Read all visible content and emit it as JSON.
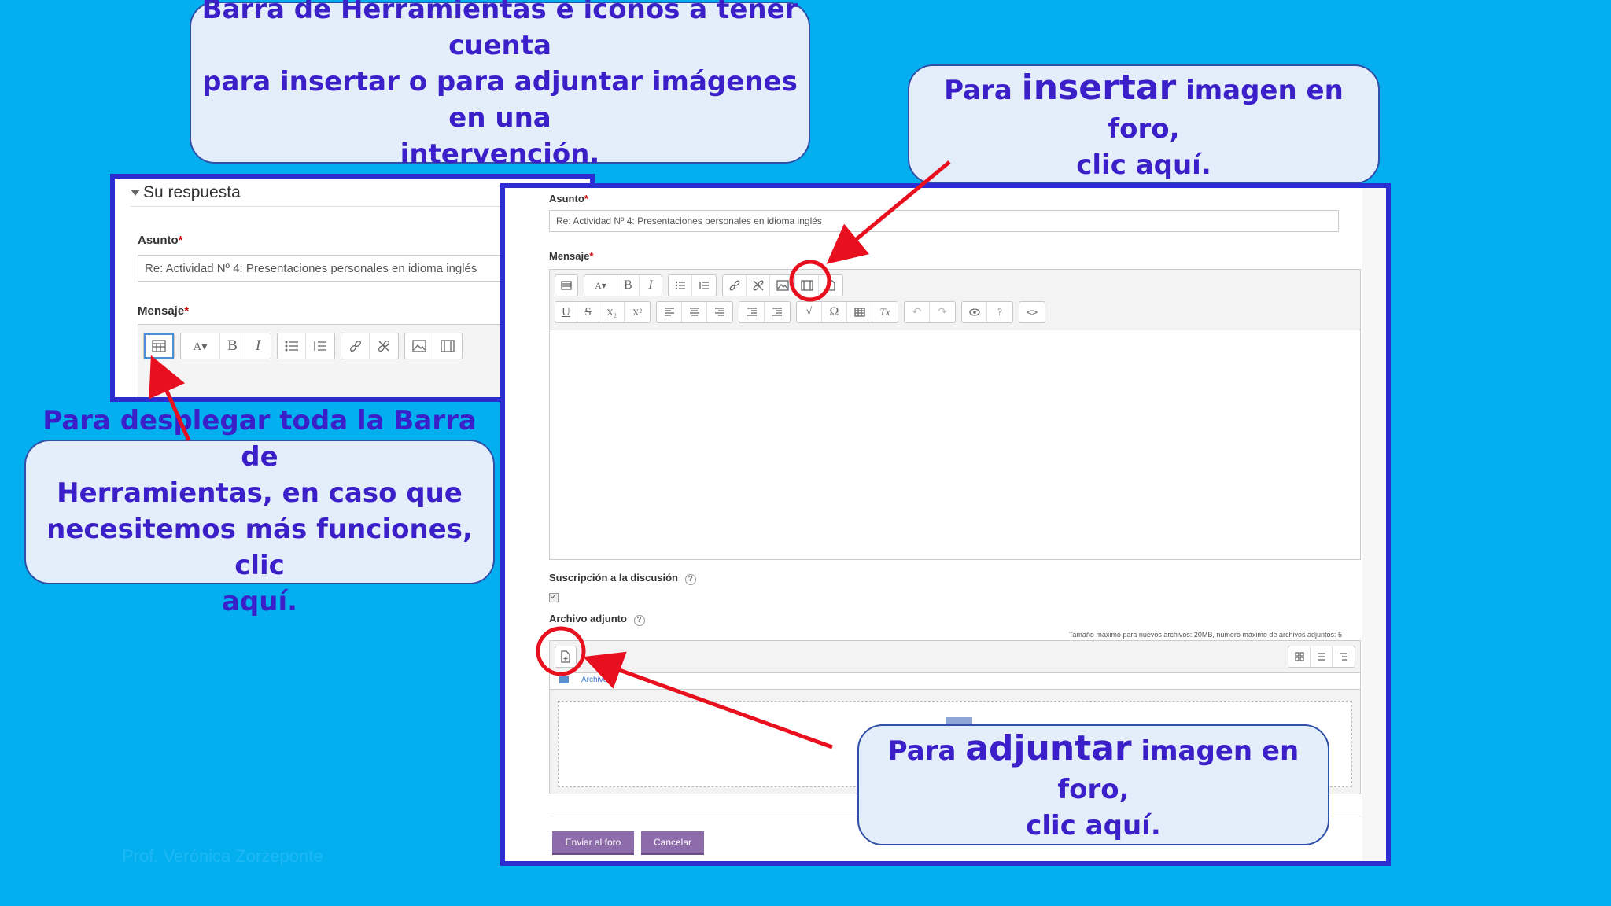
{
  "callouts": {
    "top_center": {
      "line1": "Barra de Herramientas e iconos a tener cuenta",
      "line2": "para insertar o para adjuntar imágenes en una",
      "line3": "intervención."
    },
    "insert": {
      "prefix": "Para ",
      "keyword": "insertar",
      "suffix": " imagen en foro,",
      "line2": "clic  aquí."
    },
    "toolbar": {
      "line1": "Para desplegar toda la Barra de",
      "line2": "Herramientas, en caso que",
      "line3": "necesitemos más funciones,  clic",
      "line4": "aquí."
    },
    "attach": {
      "prefix": "Para ",
      "keyword": "adjuntar",
      "suffix": " imagen en foro,",
      "line2": "clic  aquí."
    }
  },
  "left_form": {
    "section_title": "Su respuesta",
    "subject_label": "Asunto",
    "subject_value": "Re: Actividad Nº 4: Presentaciones personales en idioma inglés",
    "message_label": "Mensaje",
    "required_mark": "*"
  },
  "right_form": {
    "subject_label": "Asunto",
    "subject_value": "Re: Actividad Nº 4: Presentaciones personales en idioma inglés",
    "message_label": "Mensaje",
    "required_mark": "*",
    "subscription_label": "Suscripción a la discusión",
    "attachment_label": "Archivo adjunto",
    "max_size_note": "Tamaño máximo para nuevos archivos: 20MB, número máximo de archivos adjuntos: 5",
    "files_folder": "Archivos",
    "submit_button": "Enviar al foro",
    "cancel_button": "Cancelar"
  },
  "toolbar_glyphs": {
    "bold": "B",
    "italic": "I",
    "underline": "U",
    "strike": "S",
    "subscript": "X₂",
    "superscript": "X²",
    "omega": "Ω",
    "clear": "Tx",
    "html": "<>"
  },
  "footer_author": "Prof. Verónica Zorzeponte",
  "colors": {
    "background": "#04aff0",
    "callout_text": "#3b1fc9",
    "panel_border": "#2b2dd0",
    "highlight": "#e8101e",
    "button": "#8e6cac"
  }
}
